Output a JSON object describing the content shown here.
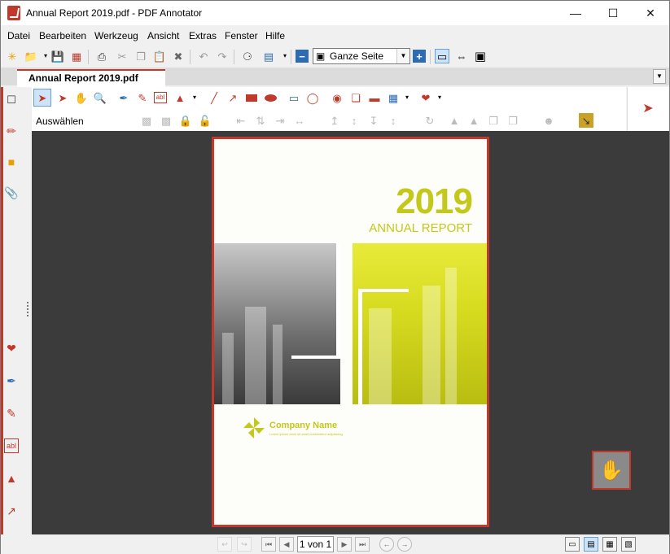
{
  "window": {
    "title": "Annual Report 2019.pdf - PDF Annotator"
  },
  "menu": [
    "Datei",
    "Bearbeiten",
    "Werkzeug",
    "Ansicht",
    "Extras",
    "Fenster",
    "Hilfe"
  ],
  "toolbar": {
    "zoom_value": "Ganze Seite"
  },
  "tabs": {
    "active": "Annual Report 2019.pdf"
  },
  "tools": {
    "label": "Auswählen"
  },
  "document": {
    "year": "2019",
    "subtitle": "ANNUAL REPORT",
    "company": "Company Name",
    "tagline": "Lorem ipsum dolor sit amet consectetur adipisicing"
  },
  "nav": {
    "page_indicator": "1 von 1"
  },
  "colors": {
    "accent": "#c0392b",
    "brand": "#c4c81a",
    "canvas": "#3b3b3b"
  }
}
